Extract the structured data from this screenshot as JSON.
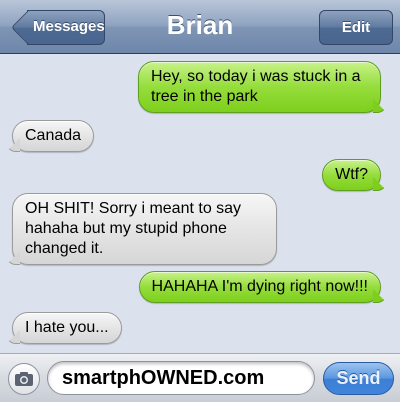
{
  "header": {
    "back_label": "Messages",
    "title": "Brian",
    "edit_label": "Edit"
  },
  "messages": [
    {
      "from": "me",
      "text": "Hey, so today i was stuck in a tree in the park"
    },
    {
      "from": "Brian",
      "text": "Canada"
    },
    {
      "from": "me",
      "text": "Wtf?"
    },
    {
      "from": "Brian",
      "text": "OH SHIT! Sorry i meant to say hahaha but my stupid phone changed it."
    },
    {
      "from": "me",
      "text": "HAHAHA I'm dying right now!!!"
    },
    {
      "from": "Brian",
      "text": "I hate you..."
    }
  ],
  "composer": {
    "field_text": "smartphOWNED.com",
    "send_label": "Send",
    "camera_icon": "camera-icon"
  },
  "colors": {
    "sent_bubble": "#95dd3c",
    "received_bubble": "#e5e5e5",
    "send_button": "#3e7fd4",
    "background": "#dbe2ed"
  }
}
